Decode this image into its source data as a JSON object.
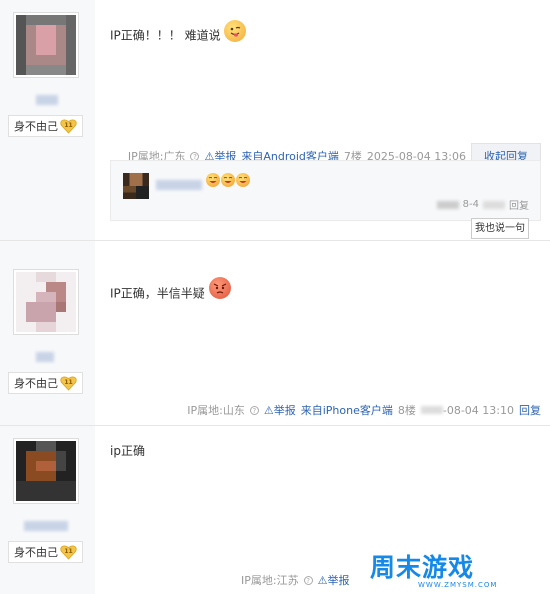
{
  "posts": [
    {
      "content": "IP正确！！！ 难道说",
      "badge": "身不由己",
      "meta": {
        "ip": "IP属地:广东",
        "report": "举报",
        "client": "来自Android客户端",
        "floor": "7楼",
        "time": "2025-08-04 13:06",
        "toggle": "收起回复"
      },
      "sub_reply": {
        "time_suffix": "8-4",
        "reply": "回复",
        "button": "我也说一句"
      }
    },
    {
      "content": "IP正确，半信半疑",
      "badge": "身不由己",
      "meta": {
        "ip": "IP属地:山东",
        "report": "举报",
        "client": "来自iPhone客户端",
        "floor": "8楼",
        "time": "-08-04 13:10",
        "reply": "回复"
      }
    },
    {
      "content": "ip正确",
      "badge": "身不由己",
      "meta": {
        "ip": "IP属地:江苏",
        "report": "举报"
      }
    }
  ],
  "watermark": {
    "brand": "周末游戏",
    "url": "WWW.ZMYSM.COM"
  },
  "colors": {
    "link": "#2d64b3",
    "side_bg": "#f7f8fa",
    "watermark": "#1688e8"
  }
}
